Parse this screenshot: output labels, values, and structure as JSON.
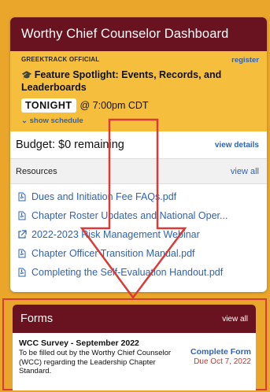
{
  "dashboard": {
    "title": "Worthy Chief Counselor Dashboard",
    "spotlight": {
      "source": "GREEKTRACK OFFICIAL",
      "register_label": "register",
      "title": "Feature Spotlight: Events, Records, and Leaderboards",
      "badge": "TONIGHT",
      "time": "@ 7:00pm CDT",
      "show_schedule": "show schedule"
    },
    "budget": {
      "text": "Budget: $0 remaining",
      "link": "view details"
    },
    "resources": {
      "title": "Resources",
      "view_all": "view all",
      "items": [
        {
          "label": "Dues and Initiation Fee FAQs.pdf",
          "icon": "pdf-icon"
        },
        {
          "label": "Chapter Roster Updates and National Oper...",
          "icon": "pdf-icon"
        },
        {
          "label": "2022-2023 Risk Management Webinar",
          "icon": "external-link-icon"
        },
        {
          "label": "Chapter Officer Transition Manual.pdf",
          "icon": "pdf-icon"
        },
        {
          "label": "Completing the Self-Evaluation Handout.pdf",
          "icon": "pdf-icon"
        }
      ]
    }
  },
  "forms": {
    "title": "Forms",
    "view_all": "view all",
    "item": {
      "title": "WCC Survey - September 2022",
      "description": "To be filled out by the Worthy Chief Counselor (WCC) regarding the Leadership Chapter Standard.",
      "action": "Complete Form",
      "due": "Due Oct 7, 2022"
    }
  },
  "colors": {
    "background": "#e9a62a",
    "header": "#6a1320",
    "spotlight": "#f5bf3d",
    "link": "#2f63b5",
    "annotation": "#d93a3a"
  }
}
